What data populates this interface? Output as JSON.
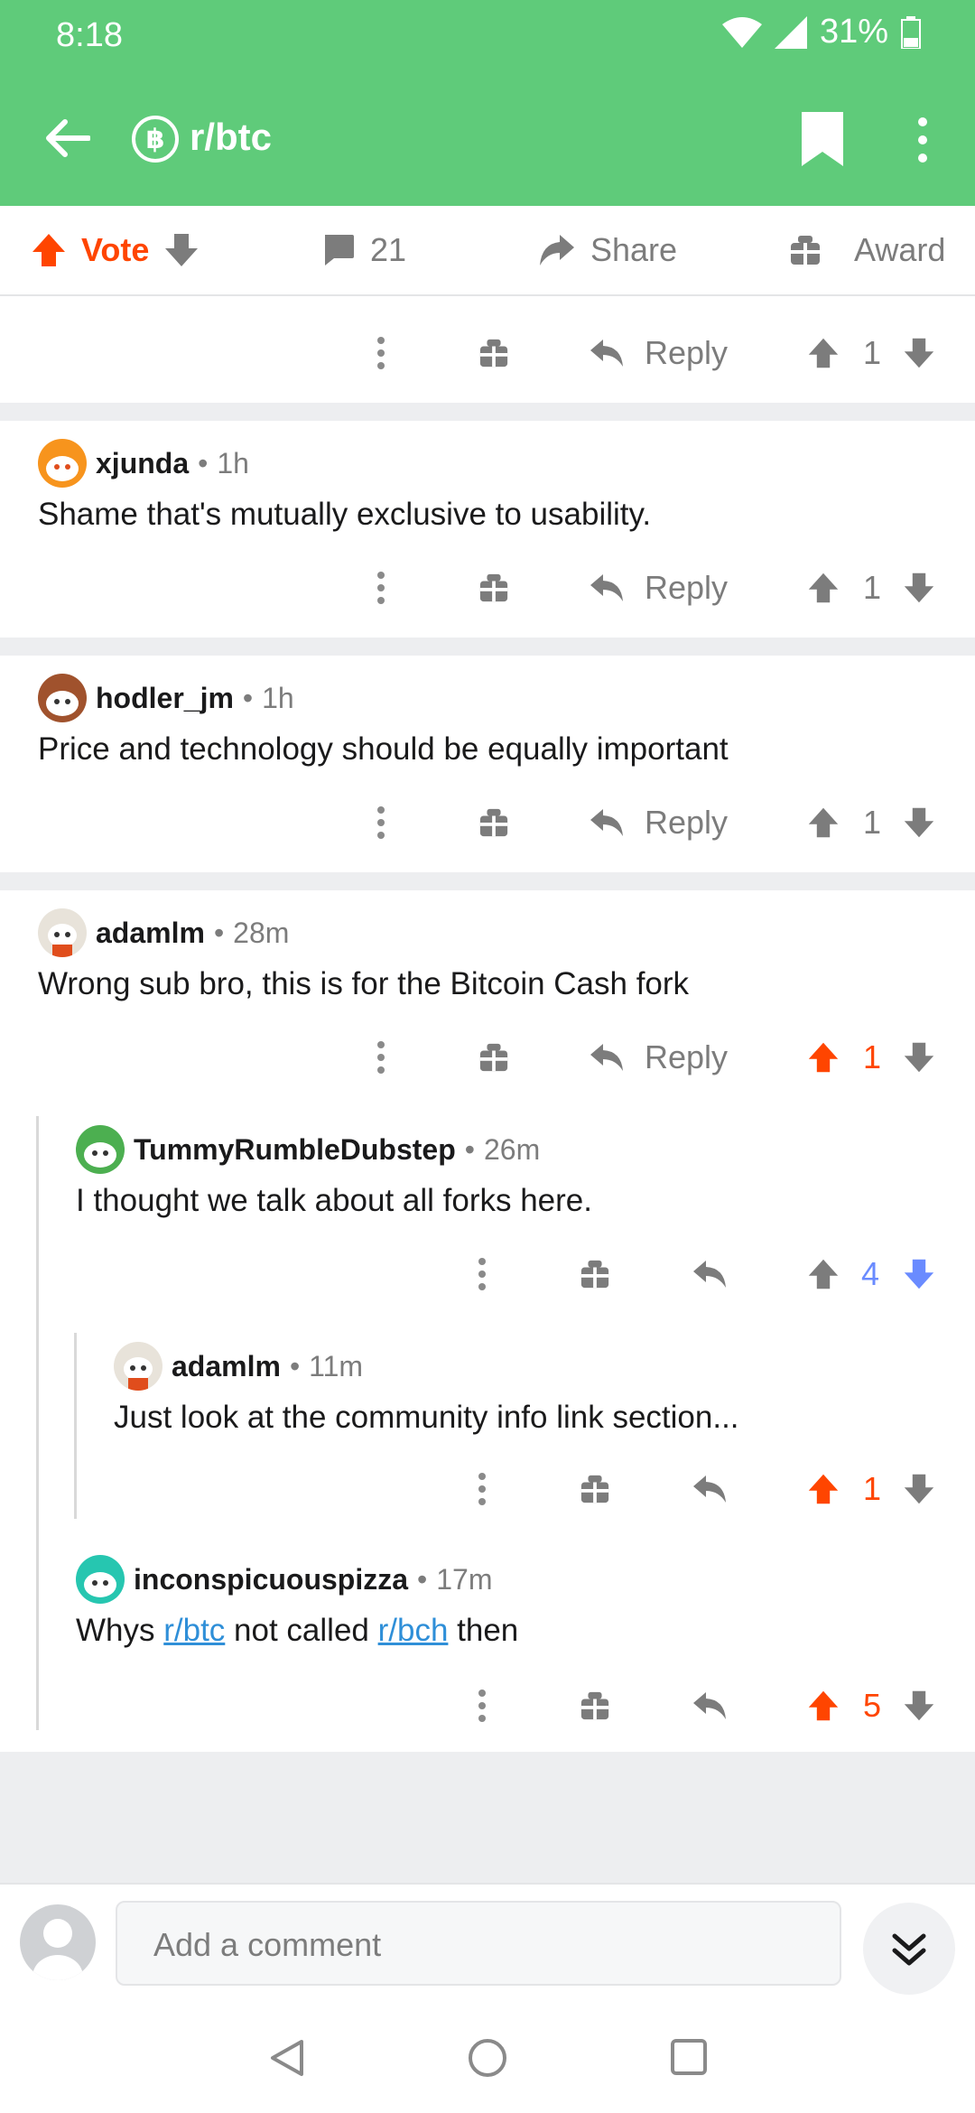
{
  "status": {
    "time": "8:18",
    "battery": "31%"
  },
  "header": {
    "subreddit": "r/btc",
    "sub_icon_letter": "฿"
  },
  "action_bar": {
    "vote_label": "Vote",
    "comment_count": "21",
    "share_label": "Share",
    "award_label": "Award"
  },
  "top_row": {
    "reply_label": "Reply",
    "score": "1"
  },
  "comments": [
    {
      "author": "xjunda",
      "time": "1h",
      "body": "Shame that's mutually exclusive to usability.",
      "reply_label": "Reply",
      "score": "1"
    },
    {
      "author": "hodler_jm",
      "time": "1h",
      "body": "Price and technology should be equally important",
      "reply_label": "Reply",
      "score": "1"
    },
    {
      "author": "adamlm",
      "time": "28m",
      "body": "Wrong sub bro, this is for the Bitcoin Cash fork",
      "reply_label": "Reply",
      "score": "1"
    }
  ],
  "replies": [
    {
      "author": "TummyRumbleDubstep",
      "time": "26m",
      "body": "I thought we talk about all forks here.",
      "score": "4"
    },
    {
      "author": "adamlm",
      "time": "11m",
      "body": "Just look at the community info link section...",
      "score": "1"
    },
    {
      "author": "inconspicuouspizza",
      "time": "17m",
      "body_prefix": "Whys",
      "link1": "r/btc",
      "body_middle": "not called",
      "link2": "r/bch",
      "body_suffix": "then",
      "score": "5"
    }
  ],
  "compose": {
    "placeholder": "Add a comment"
  },
  "colors": {
    "header": "#5fcb7a",
    "upvote": "#ff4500",
    "downvote": "#6a8bff",
    "link": "#2f8fd8"
  }
}
